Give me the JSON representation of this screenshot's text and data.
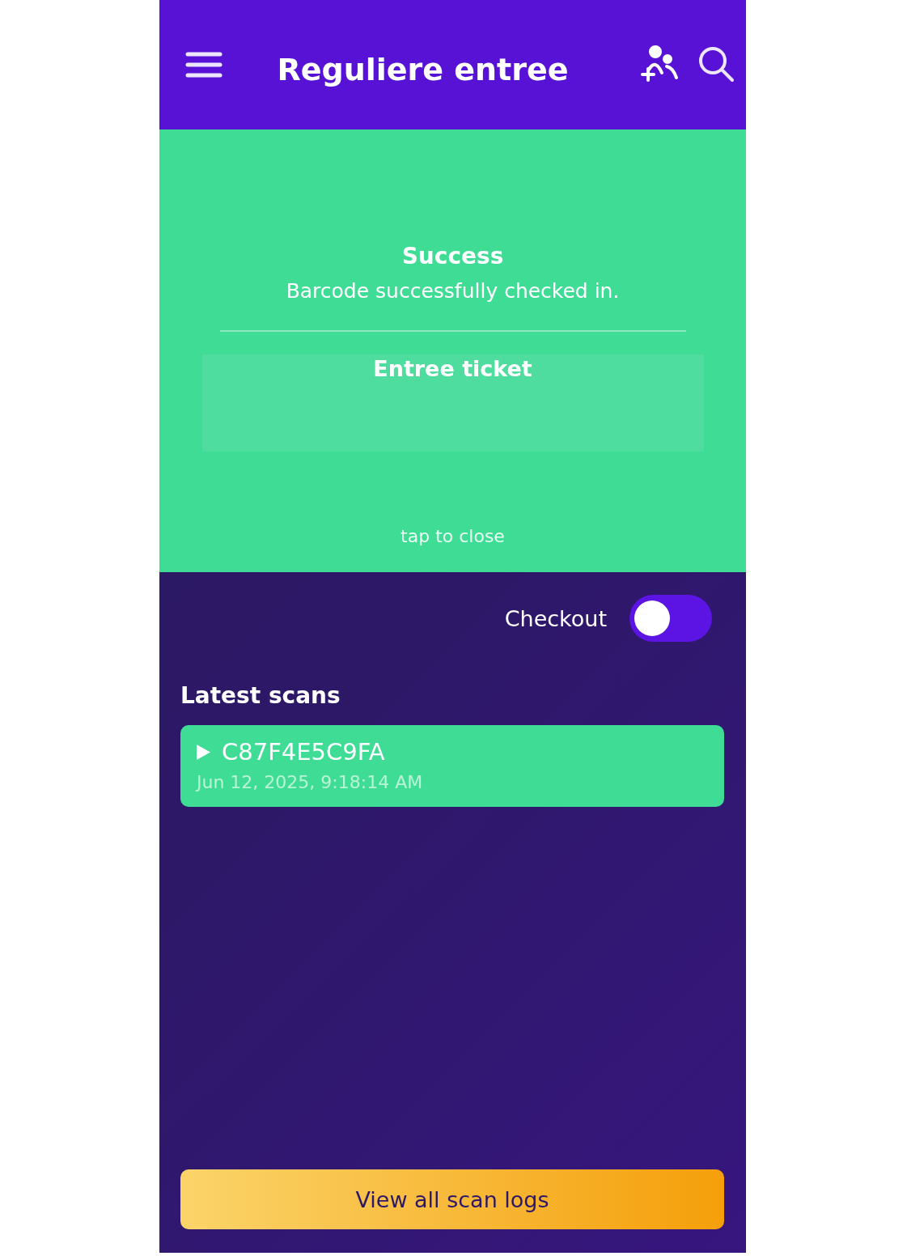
{
  "header": {
    "title": "Reguliere entree"
  },
  "result": {
    "status": "Success",
    "message": "Barcode successfully checked in.",
    "ticket_type": "Entree ticket",
    "hint": "tap to close"
  },
  "checkout": {
    "label": "Checkout",
    "on": false
  },
  "latest_scans": {
    "title": "Latest scans",
    "items": [
      {
        "code": "C87F4E5C9FA",
        "time": "Jun 12, 2025, 9:18:14 AM",
        "expanded": false
      }
    ]
  },
  "footer_button": {
    "label": "View all scan logs"
  }
}
